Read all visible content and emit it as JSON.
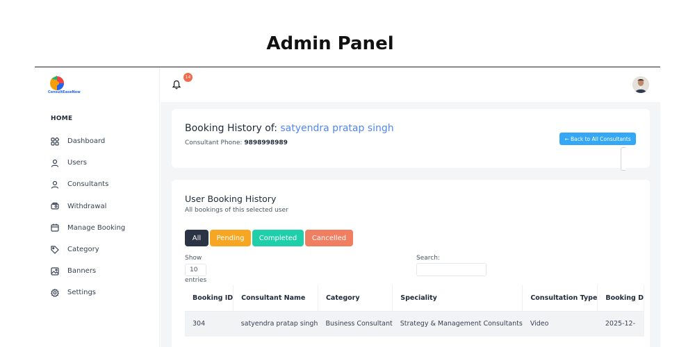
{
  "caption": "Admin Panel",
  "sidebar": {
    "logo_text": "ConsultEaseNow",
    "section_label": "HOME",
    "items": [
      {
        "label": "Dashboard",
        "icon": "dashboard-icon"
      },
      {
        "label": "Users",
        "icon": "user-icon"
      },
      {
        "label": "Consultants",
        "icon": "user-icon"
      },
      {
        "label": "Withdrawal",
        "icon": "wallet-icon"
      },
      {
        "label": "Manage Booking",
        "icon": "calendar-icon"
      },
      {
        "label": "Category",
        "icon": "tag-icon"
      },
      {
        "label": "Banners",
        "icon": "image-icon"
      },
      {
        "label": "Settings",
        "icon": "gear-icon"
      }
    ]
  },
  "topbar": {
    "notification_count": "14"
  },
  "booking_card": {
    "title_prefix": "Booking History of:",
    "consultant_name": "satyendra pratap singh",
    "phone_label": "Consultant Phone:",
    "phone_value": "9898998989",
    "back_button": "← Back to All Consultants"
  },
  "history": {
    "title": "User Booking History",
    "subtitle": "All bookings of this selected user",
    "filters": [
      {
        "label": "All",
        "color": "#2b3445"
      },
      {
        "label": "Pending",
        "color": "#f6a623"
      },
      {
        "label": "Completed",
        "color": "#1fcfaa"
      },
      {
        "label": "Cancelled",
        "color": "#f07f62"
      }
    ],
    "show_label": "Show",
    "show_value": "10",
    "entries_label": "entries",
    "search_label": "Search:",
    "columns": [
      "Booking ID",
      "Consultant Name",
      "Category",
      "Speciality",
      "Consultation Type",
      "Booking D"
    ],
    "rows": [
      [
        "304",
        "satyendra pratap singh",
        "Business Consultant",
        "Strategy & Management Consultants",
        "Video",
        "2025-12-"
      ]
    ]
  }
}
